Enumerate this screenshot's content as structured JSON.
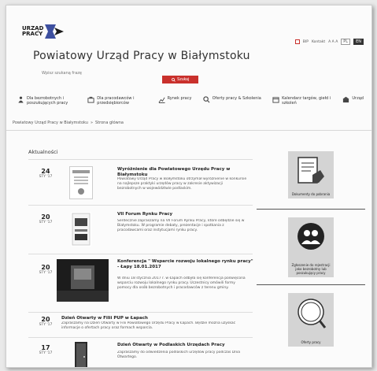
{
  "logo": {
    "line1": "URZĄD",
    "line2": "PRACY"
  },
  "header": {
    "title": "Powiatowy Urząd Pracy w Białymstoku",
    "search_placeholder": "Wpisz szukaną frazę",
    "search_button": "Szukaj"
  },
  "toplinks": {
    "bip": "BIP",
    "contact": "Kontakt",
    "font": "A A A",
    "lang_pl": "PL",
    "lang_alt": "EN"
  },
  "nav": [
    {
      "label": "Dla bezrobotnych i poszukujących pracy",
      "icon": "person-icon"
    },
    {
      "label": "Dla pracodawców i przedsiębiorców",
      "icon": "briefcase-icon"
    },
    {
      "label": "Rynek pracy",
      "icon": "chart-icon"
    },
    {
      "label": "Oferty pracy & Szkolenia",
      "icon": "search-icon"
    },
    {
      "label": "Kalendarz targów, giełd i szkoleń",
      "icon": "calendar-icon"
    },
    {
      "label": "Urząd",
      "icon": "building-icon"
    }
  ],
  "breadcrumb": {
    "home": "Powiatowy Urząd Pracy w Białymstoku",
    "sep": "»",
    "current": "Strona główna"
  },
  "section_title": "Aktualności",
  "news": [
    {
      "day": "24",
      "month": "STY '17",
      "title": "Wyróżnienie dla Powiatowego Urzędu Pracy w Białymstoku",
      "text": "Powiatowy Urząd Pracy w Białymstoku otrzymał wyróżnienie w konkursie na najlepsze praktyki urzędów pracy w zakresie aktywizacji bezrobotnych w województwie podlaskim."
    },
    {
      "day": "20",
      "month": "STY '17",
      "title": "VII Forum Rynku Pracy",
      "text": "Serdecznie zapraszamy na VII Forum Rynku Pracy, które odbędzie się w Białymstoku. W programie debaty, prezentacje i spotkania z pracodawcami oraz instytucjami rynku pracy."
    },
    {
      "day": "20",
      "month": "STY '17",
      "title": "Konferencja \" Wsparcie rozwoju lokalnego rynku pracy\" - Łapy 18.01.2017",
      "text": "W dniu 18 stycznia 2017 r. w Łapach odbyła się konferencja poświęcona wsparciu rozwoju lokalnego rynku pracy. Uczestnicy omówili formy pomocy dla osób bezrobotnych i pracodawców z terenu gminy."
    },
    {
      "day": "20",
      "month": "STY '17",
      "title": "Dzień Otwarty w Filii PUP w Łapach",
      "text": "Zapraszamy na Dzień Otwarty w Filii Powiatowego Urzędu Pracy w Łapach. Będzie można uzyskać informacje o ofertach pracy oraz formach wsparcia."
    },
    {
      "day": "17",
      "month": "STY '17",
      "title": "Dzień Otwarty w Podlaskich Urzędach Pracy",
      "text": "Zapraszamy do odwiedzenia podlaskich urzędów pracy podczas Dnia Otwartego."
    }
  ],
  "sidebar": [
    {
      "label": "Dokumenty do pobrania",
      "icon": "document-hand-icon"
    },
    {
      "label": "Zgłoszenie do rejestracji jako bezrobotny lub poszukujący pracy",
      "icon": "people-icon"
    },
    {
      "label": "Oferty pracy",
      "icon": "job-offers-icon"
    }
  ],
  "colors": {
    "accent": "#c9302c",
    "logo_blue": "#3d4f9f"
  }
}
